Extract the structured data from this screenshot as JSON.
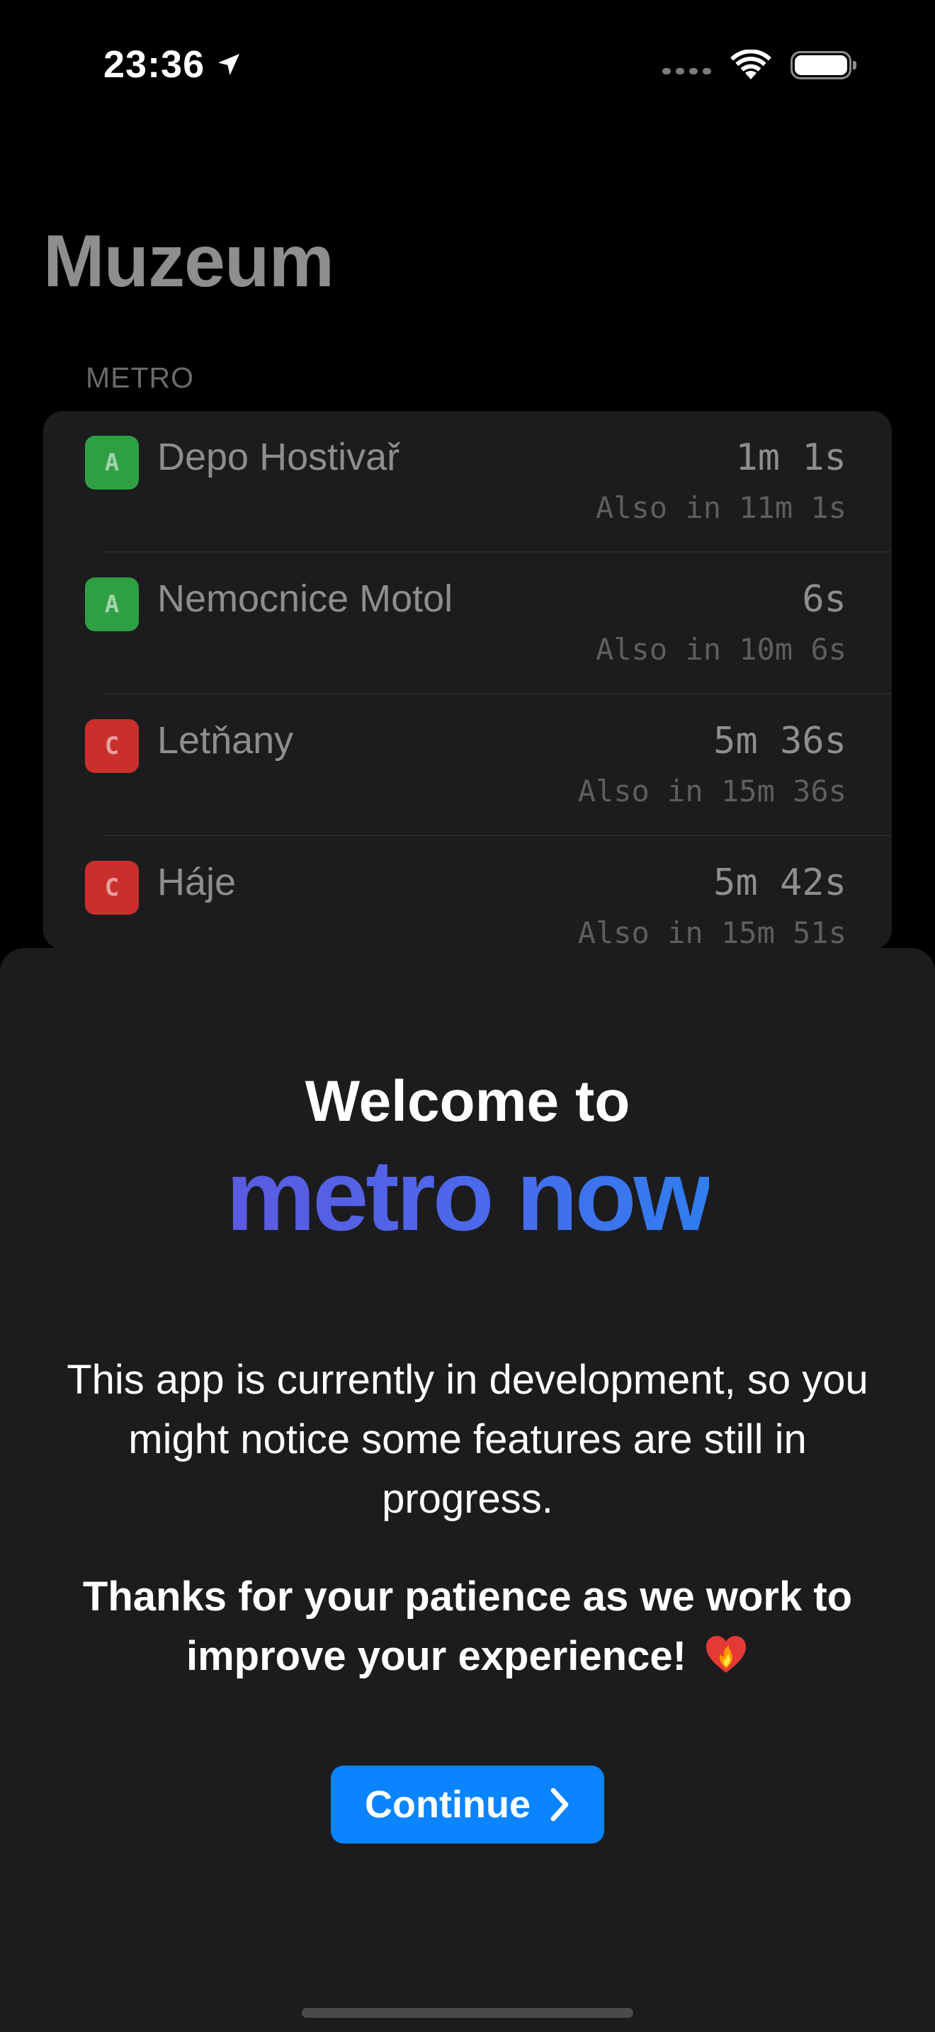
{
  "status_bar": {
    "time": "23:36"
  },
  "page": {
    "title": "Muzeum",
    "section_header": "METRO"
  },
  "departures": [
    {
      "line": "A",
      "line_color": "#2ea043",
      "destination": "Depo Hostivař",
      "time": "1m 1s",
      "also": "Also in 11m 1s"
    },
    {
      "line": "A",
      "line_color": "#2ea043",
      "destination": "Nemocnice Motol",
      "time": "6s",
      "also": "Also in 10m 6s"
    },
    {
      "line": "C",
      "line_color": "#c9302c",
      "destination": "Letňany",
      "time": "5m 36s",
      "also": "Also in 15m 36s"
    },
    {
      "line": "C",
      "line_color": "#c9302c",
      "destination": "Háje",
      "time": "5m 42s",
      "also": "Also in 15m 51s"
    }
  ],
  "welcome": {
    "heading": "Welcome to",
    "brand": "metro now",
    "paragraph_1": "This app is currently in development, so you might notice some features are still in progress.",
    "paragraph_2": "Thanks for your patience as we work to improve your experience!",
    "continue_label": "Continue"
  },
  "colors": {
    "accent": "#0a84ff",
    "brand_gradient_start": "#5a5be0",
    "brand_gradient_end": "#2f7ef0",
    "line_a": "#2ea043",
    "line_c": "#c9302c"
  },
  "icons": [
    "location-arrow-icon",
    "signal-dots-icon",
    "wifi-icon",
    "battery-icon",
    "heart-on-fire-icon",
    "chevron-right-icon"
  ]
}
